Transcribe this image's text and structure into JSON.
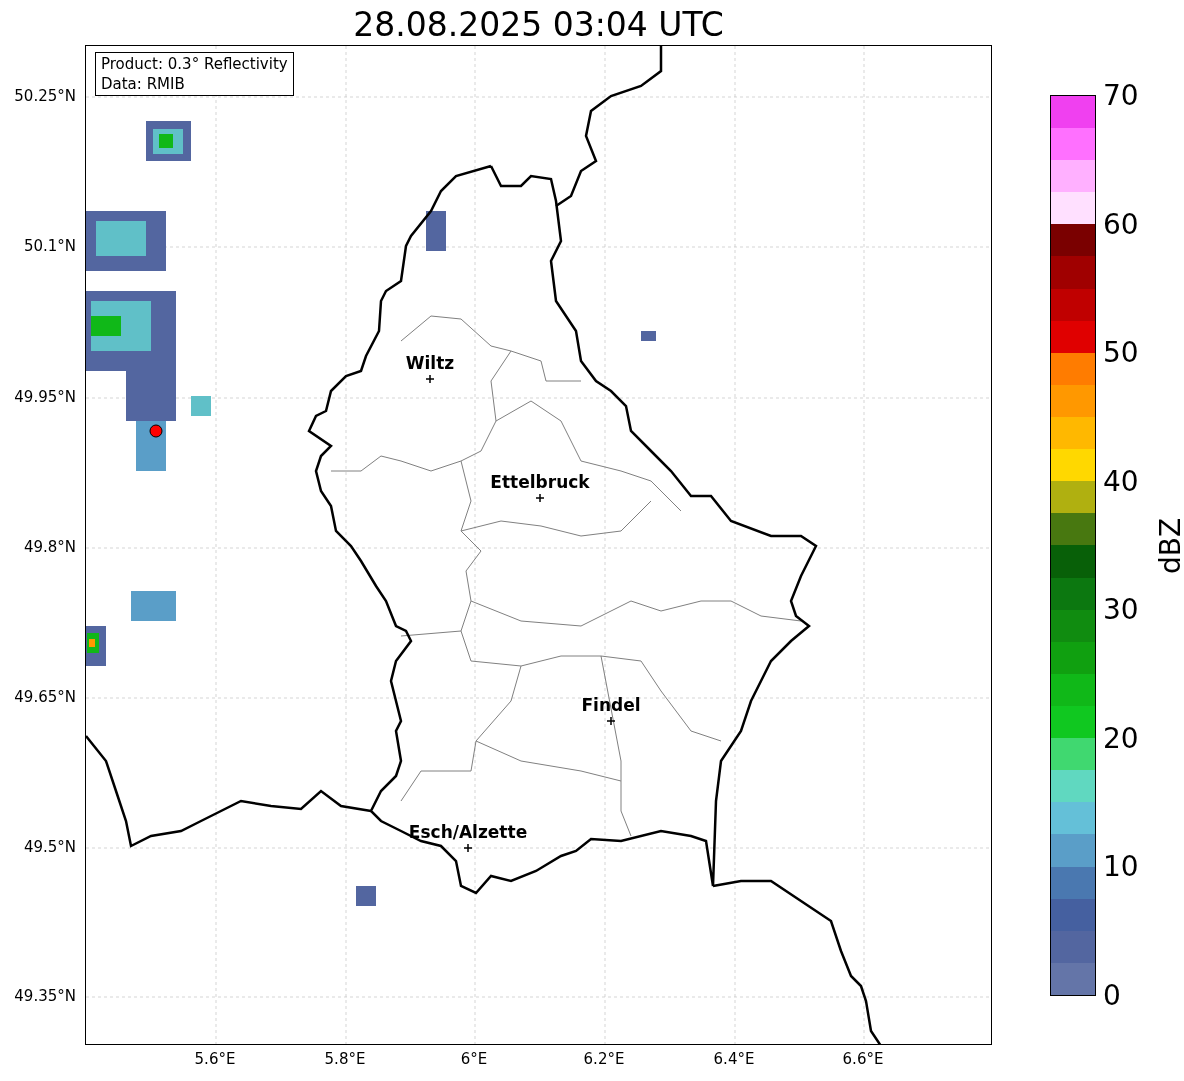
{
  "title": "28.08.2025 03:04 UTC",
  "legend": [
    "Product: 0.3° Reflectivity",
    "Data: RMIB"
  ],
  "y_ticks": [
    "50.25°N",
    "50.1°N",
    "49.95°N",
    "49.8°N",
    "49.65°N",
    "49.5°N",
    "49.35°N"
  ],
  "x_ticks": [
    "5.6°E",
    "5.8°E",
    "6°E",
    "6.2°E",
    "6.4°E",
    "6.6°E"
  ],
  "cities": [
    {
      "name": "Wiltz"
    },
    {
      "name": "Ettelbruck"
    },
    {
      "name": "Findel"
    },
    {
      "name": "Esch/Alzette"
    }
  ],
  "colorbar": {
    "label": "dBZ",
    "ticks": [
      "70",
      "60",
      "50",
      "40",
      "30",
      "20",
      "10",
      "0"
    ],
    "segments": [
      {
        "color": "#6475a8"
      },
      {
        "color": "#5366a0"
      },
      {
        "color": "#4560a0"
      },
      {
        "color": "#4a78b0"
      },
      {
        "color": "#5a9ec8"
      },
      {
        "color": "#64c0d8"
      },
      {
        "color": "#60d8c0"
      },
      {
        "color": "#40d870"
      },
      {
        "color": "#10c820"
      },
      {
        "color": "#10b818"
      },
      {
        "color": "#10a010"
      },
      {
        "color": "#108c10"
      },
      {
        "color": "#0c7810"
      },
      {
        "color": "#086008"
      },
      {
        "color": "#487810"
      },
      {
        "color": "#b0b010"
      },
      {
        "color": "#ffd800"
      },
      {
        "color": "#ffb800"
      },
      {
        "color": "#ff9800"
      },
      {
        "color": "#ff7c00"
      },
      {
        "color": "#e00000"
      },
      {
        "color": "#c00000"
      },
      {
        "color": "#a00000"
      },
      {
        "color": "#7a0000"
      },
      {
        "color": "#ffe0ff"
      },
      {
        "color": "#ffb0ff"
      },
      {
        "color": "#ff70ff"
      },
      {
        "color": "#f040f0"
      }
    ]
  }
}
